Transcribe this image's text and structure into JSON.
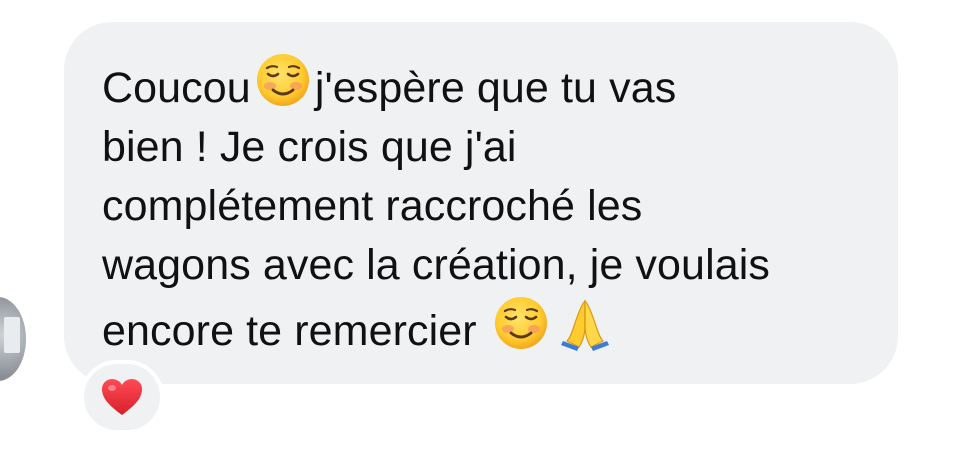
{
  "message": {
    "line1_a": "Coucou",
    "line1_b": "j'espère que tu vas",
    "line2": "bien ! Je crois que j'ai",
    "line3": "complétement raccroché les",
    "line4": "wagons avec la création, je voulais",
    "line5": "encore te remercier",
    "emojis": [
      "smiling-face-with-blush",
      "folded-hands"
    ]
  },
  "reaction": {
    "icon": "red-heart",
    "color": "#e0262f"
  },
  "colors": {
    "bubble": "#f0f1f3",
    "text": "#111111"
  }
}
